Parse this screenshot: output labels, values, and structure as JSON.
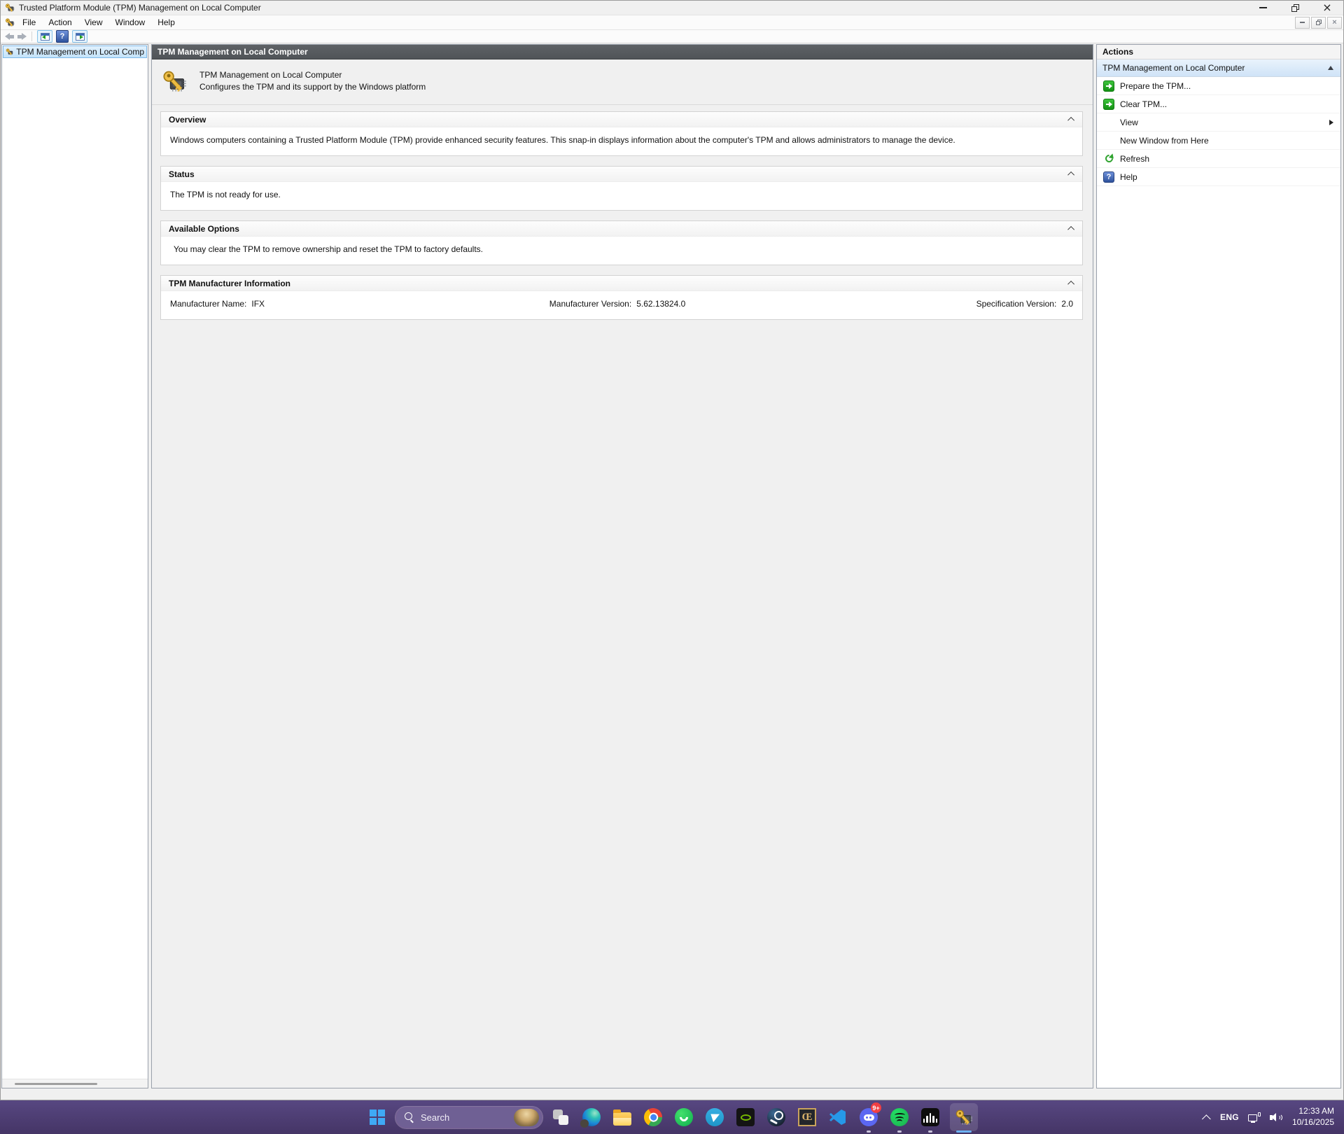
{
  "window": {
    "title": "Trusted Platform Module (TPM) Management on Local Computer"
  },
  "menu": {
    "items": [
      "File",
      "Action",
      "View",
      "Window",
      "Help"
    ]
  },
  "tree": {
    "selected_item": "TPM Management on Local Comp"
  },
  "content": {
    "header": "TPM Management on Local Computer",
    "banner_title": "TPM Management on Local Computer",
    "banner_subtitle": "Configures the TPM and its support by the Windows platform",
    "sections": [
      {
        "title": "Overview",
        "body": "Windows computers containing a Trusted Platform Module (TPM) provide enhanced security features. This snap-in displays information about the computer's TPM and allows administrators to manage the device."
      },
      {
        "title": "Status",
        "body": "The TPM is not ready for use."
      },
      {
        "title": "Available Options",
        "body": "You may clear the TPM to remove ownership and reset the TPM to factory defaults."
      },
      {
        "title": "TPM Manufacturer Information",
        "fields": [
          {
            "label": "Manufacturer Name:",
            "value": "IFX"
          },
          {
            "label": "Manufacturer Version:",
            "value": "5.62.13824.0"
          },
          {
            "label": "Specification Version:",
            "value": "2.0"
          }
        ]
      }
    ]
  },
  "actions": {
    "header": "Actions",
    "group_title": "TPM Management on Local Computer",
    "items": [
      {
        "label": "Prepare the TPM...",
        "icon": "green-arrow-icon"
      },
      {
        "label": "Clear TPM...",
        "icon": "green-arrow-icon"
      },
      {
        "label": "View",
        "icon": "none",
        "submenu": true
      },
      {
        "label": "New Window from Here",
        "icon": "none"
      },
      {
        "label": "Refresh",
        "icon": "refresh-icon"
      },
      {
        "label": "Help",
        "icon": "help-icon"
      }
    ]
  },
  "taskbar": {
    "search_placeholder": "Search",
    "discord_badge": "9+",
    "ce_glyph": "Œ",
    "icons": [
      "start",
      "search",
      "task-view",
      "edge",
      "file-explorer",
      "chrome",
      "whatsapp",
      "telegram",
      "nvidia",
      "steam",
      "ce-app",
      "vscode",
      "discord",
      "spotify",
      "equalizer",
      "tpm-management"
    ],
    "tray": {
      "language": "ENG",
      "time": "12:33 AM",
      "date": "10/16/2025"
    }
  },
  "colors": {
    "taskbar_purple": "#4e3f73",
    "start_blue": "#3fa9f5",
    "selection_blue": "#c3e3fa",
    "header_gray": "#54585c",
    "action_green": "#1d9e1d",
    "badge_red": "#f23f42",
    "active_underline": "#6cb2f2"
  }
}
